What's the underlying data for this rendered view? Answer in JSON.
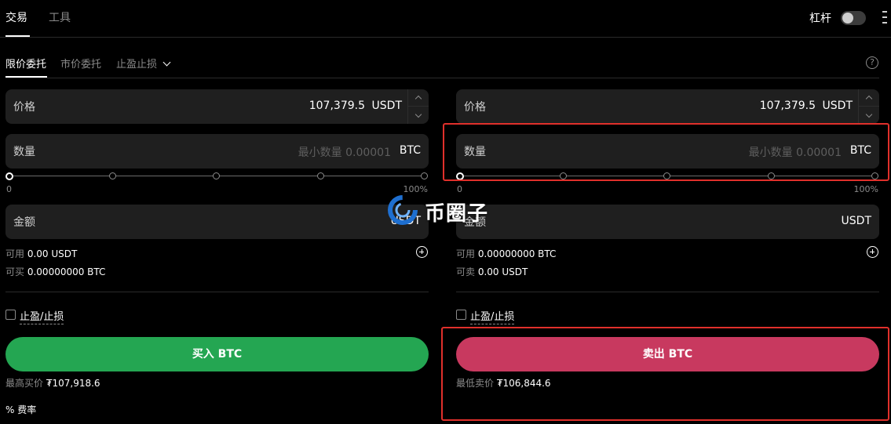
{
  "header": {
    "tabs": [
      {
        "label": "交易"
      },
      {
        "label": "工具"
      }
    ],
    "leverage_label": "杠杆"
  },
  "order_tabs": [
    {
      "label": "限价委托"
    },
    {
      "label": "市价委托"
    },
    {
      "label": "止盈止损"
    }
  ],
  "help_icon": "?",
  "buy": {
    "price_label": "价格",
    "price_value": "107,379.5",
    "price_unit": "USDT",
    "qty_label": "数量",
    "qty_placeholder": "最小数量 0.00001",
    "qty_unit": "BTC",
    "slider_min": "0",
    "slider_max": "100%",
    "slider_value_percent": 0,
    "amount_label": "金额",
    "amount_unit": "USDT",
    "avail_label": "可用",
    "avail_value": "0.00 USDT",
    "can_label": "可买",
    "can_value": "0.00000000 BTC",
    "tpsl_label": "止盈/止损",
    "button_label": "买入 BTC",
    "best_label": "最高买价",
    "best_value": "₮107,918.6",
    "fee_label": "% 费率"
  },
  "sell": {
    "price_label": "价格",
    "price_value": "107,379.5",
    "price_unit": "USDT",
    "qty_label": "数量",
    "qty_placeholder": "最小数量 0.00001",
    "qty_unit": "BTC",
    "slider_min": "0",
    "slider_max": "100%",
    "slider_value_percent": 0,
    "amount_label": "金额",
    "amount_unit": "USDT",
    "avail_label": "可用",
    "avail_value": "0.00000000 BTC",
    "can_label": "可卖",
    "can_value": "0.00 USDT",
    "tpsl_label": "止盈/止损",
    "button_label": "卖出 BTC",
    "best_label": "最低卖价",
    "best_value": "₮106,844.6"
  },
  "watermark": {
    "text": "币圈子"
  },
  "colors": {
    "buy": "#24a652",
    "sell": "#c8395f",
    "highlight": "#e0302b",
    "field_bg": "#1f1f1f"
  }
}
